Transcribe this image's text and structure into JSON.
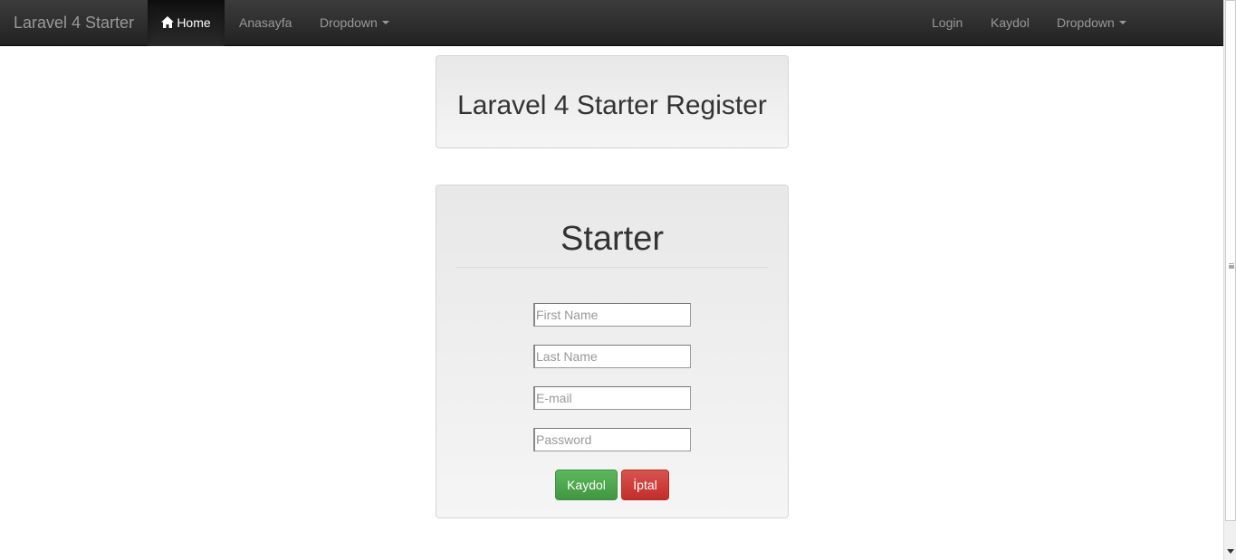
{
  "navbar": {
    "brand": "Laravel 4 Starter",
    "left_items": [
      {
        "label": "Home",
        "icon": "home-icon",
        "active": true
      },
      {
        "label": "Anasayfa"
      },
      {
        "label": "Dropdown",
        "has_caret": true
      }
    ],
    "right_items": [
      {
        "label": "Login"
      },
      {
        "label": "Kaydol"
      },
      {
        "label": "Dropdown",
        "has_caret": true
      }
    ]
  },
  "header": {
    "title": "Laravel 4 Starter Register"
  },
  "form": {
    "heading": "Starter",
    "fields": [
      {
        "placeholder": "First Name",
        "value": ""
      },
      {
        "placeholder": "Last Name",
        "value": ""
      },
      {
        "placeholder": "E-mail",
        "value": ""
      },
      {
        "placeholder": "Password",
        "value": ""
      }
    ],
    "submit_label": "Kaydol",
    "cancel_label": "İptal"
  },
  "colors": {
    "navbar_bg": "#222222",
    "success": "#5cb85c",
    "danger": "#d9534f"
  }
}
